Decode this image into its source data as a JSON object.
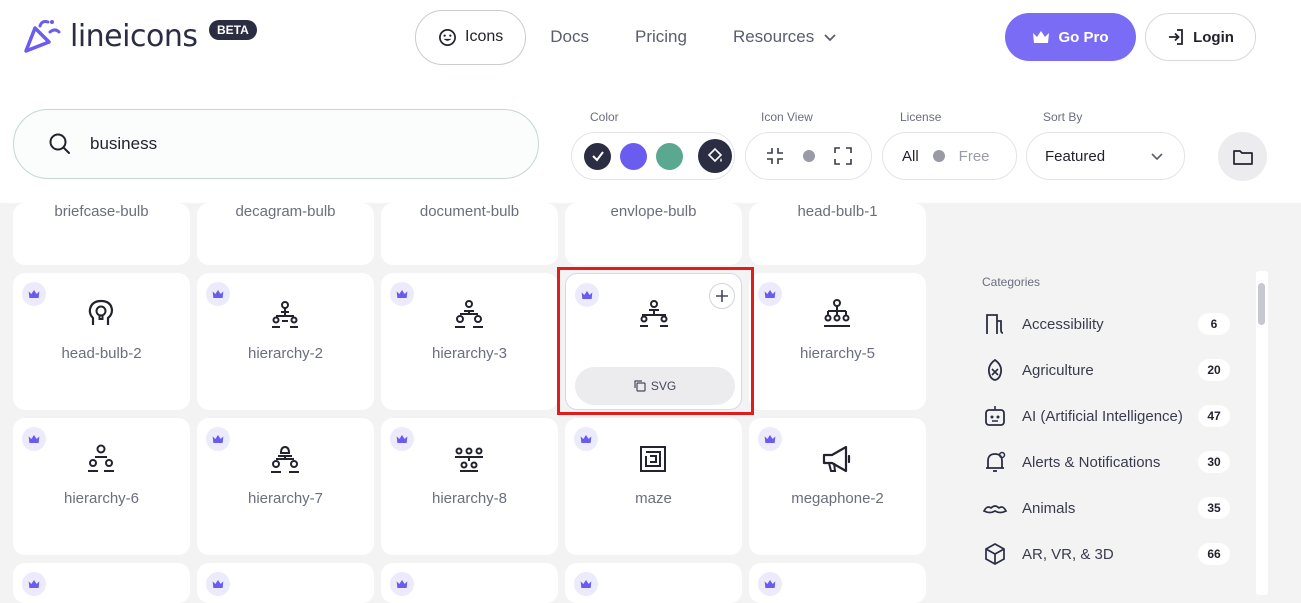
{
  "header": {
    "logo_text": "lineicons",
    "badge": "BETA",
    "nav_active": "Icons",
    "nav": [
      "Docs",
      "Pricing",
      "Resources"
    ],
    "gopro": "Go Pro",
    "login": "Login"
  },
  "search": {
    "value": "business"
  },
  "filters": {
    "color_label": "Color",
    "colors": [
      "#2b2d42",
      "#6b5cf0",
      "#5aa890"
    ],
    "iconview_label": "Icon View",
    "license_label": "License",
    "license_all": "All",
    "license_free": "Free",
    "sort_label": "Sort By",
    "sort_value": "Featured"
  },
  "icons_top": [
    "briefcase-bulb",
    "decagram-bulb",
    "document-bulb",
    "envlope-bulb",
    "head-bulb-1"
  ],
  "icons_row2": [
    "head-bulb-2",
    "hierarchy-2",
    "hierarchy-3",
    "",
    "hierarchy-5"
  ],
  "icons_row3": [
    "hierarchy-6",
    "hierarchy-7",
    "hierarchy-8",
    "maze",
    "megaphone-2"
  ],
  "hover_card": {
    "button": "SVG"
  },
  "sidebar": {
    "heading": "Categories",
    "categories": [
      {
        "label": "Accessibility",
        "count": "6"
      },
      {
        "label": "Agriculture",
        "count": "20"
      },
      {
        "label": "AI (Artificial Intelligence)",
        "count": "47"
      },
      {
        "label": "Alerts & Notifications",
        "count": "30"
      },
      {
        "label": "Animals",
        "count": "35"
      },
      {
        "label": "AR, VR, & 3D",
        "count": "66"
      }
    ]
  }
}
